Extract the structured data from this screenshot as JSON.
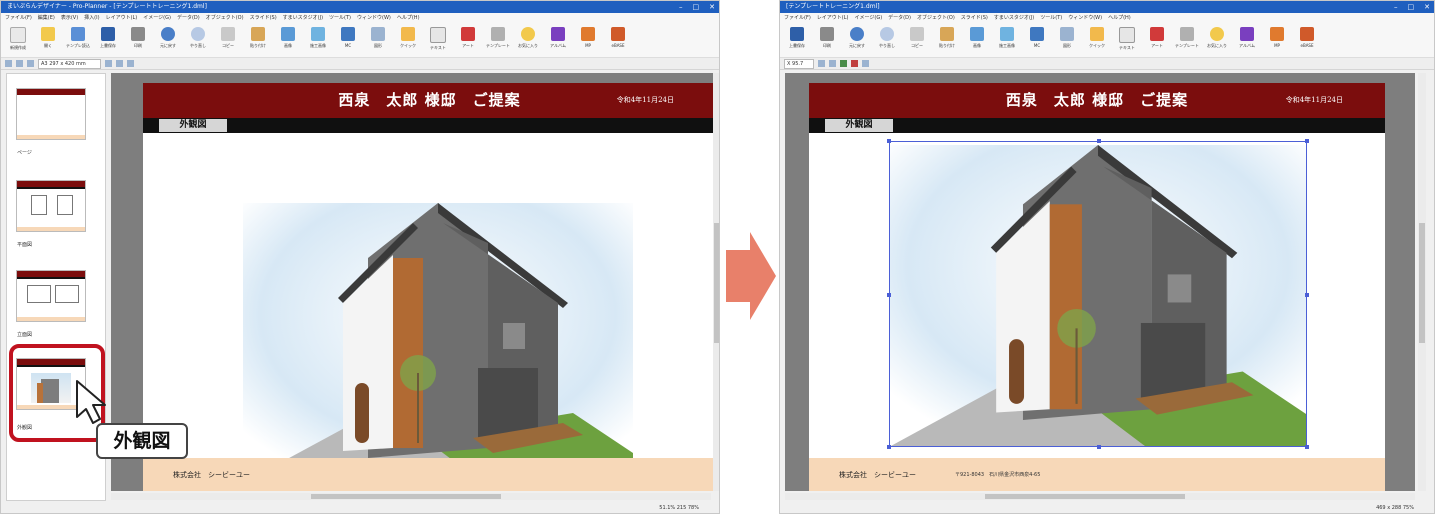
{
  "left_window": {
    "title": "まいぷらんデザイナー - Pro-Planner - [テンプレートトレーニング1.dml]",
    "menu": [
      "ファイル(F)",
      "編集(E)",
      "表示(V)",
      "挿入(I)",
      "レイアウト(L)",
      "イメージ(G)",
      "データ(D)",
      "オブジェクト(O)",
      "スライド(S)",
      "すまいスタジオ(J)",
      "ツール(T)",
      "ウィンドウ(W)",
      "ヘルプ(H)"
    ],
    "ribbon": [
      "新規作成",
      "開く",
      "テンプレ読込",
      "上書保存",
      "印刷",
      "元に戻す",
      "やり直し",
      "コピー",
      "貼り付け",
      "画像",
      "施工画像",
      "MC",
      "図形",
      "クイック",
      "テキスト",
      "アート",
      "テンプレート",
      "お気に入り",
      "アルバム",
      "MP",
      "eBASE"
    ],
    "toolbar_text": "A3 297 x 420 mm",
    "page_tree": [
      {
        "label": "ページ"
      },
      {
        "label": "平面図"
      },
      {
        "label": "立面図"
      },
      {
        "label": "外観図"
      }
    ],
    "status": "51.1%  215  78%"
  },
  "right_window": {
    "title": "[テンプレートトレーニング1.dml]",
    "menu": [
      "ファイル(F)",
      "レイアウト(L)",
      "イメージ(G)",
      "データ(D)",
      "オブジェクト(O)",
      "スライド(S)",
      "すまいスタジオ(J)",
      "ツール(T)",
      "ウィンドウ(W)",
      "ヘルプ(H)"
    ],
    "ribbon": [
      "上書保存",
      "印刷",
      "元に戻す",
      "やり直し",
      "コピー",
      "貼り付け",
      "画像",
      "施工画像",
      "MC",
      "図形",
      "クイック",
      "テキスト",
      "アート",
      "テンプレート",
      "お気に入り",
      "アルバム",
      "MP",
      "eBASE"
    ],
    "toolbar_text": "X 95.7",
    "status": "469 x 288  75%"
  },
  "document": {
    "title": "西泉　太郎 様邸　ご提案",
    "date": "令和4年11月24日",
    "section_label": "外観図",
    "footer_company": "株式会社　シービーユー",
    "footer_address": "〒921-8043　石川県金沢市西泉4-65"
  },
  "callout_label": "外観図",
  "colors": {
    "header": "#7b0d0d",
    "footer": "#f7d8b8",
    "highlight": "#c0121f",
    "arrow": "#e8806a",
    "selection": "#4b5fd6"
  }
}
